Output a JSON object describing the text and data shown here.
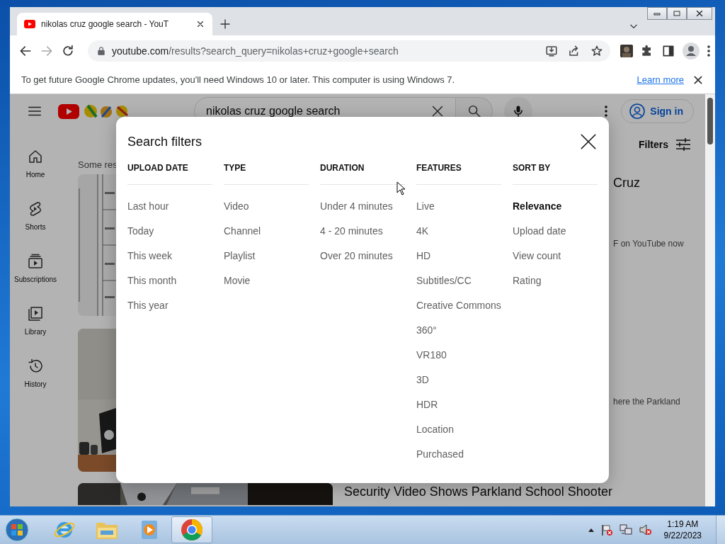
{
  "browser": {
    "tab": {
      "title": "nikolas cruz google search - YouT"
    },
    "address": {
      "domain": "youtube.com",
      "path": "/results?search_query=nikolas+cruz+google+search"
    },
    "infobar": {
      "message": "To get future Google Chrome updates, you'll need Windows 10 or later. This computer is using Windows 7.",
      "link": "Learn more"
    }
  },
  "page": {
    "search": {
      "value": "nikolas cruz google search"
    },
    "sign_in": "Sign in",
    "filters_button": "Filters",
    "guide": [
      {
        "label": "Home"
      },
      {
        "label": "Shorts"
      },
      {
        "label": "Subscriptions"
      },
      {
        "label": "Library"
      },
      {
        "label": "History"
      }
    ],
    "results_note": "Some res",
    "results": [
      {
        "title": "Cruz",
        "snippet": "F on YouTube now"
      },
      {
        "snippet": "here the Parkland"
      },
      {
        "title": "Security Video Shows Parkland School Shooter"
      }
    ]
  },
  "filters": {
    "title": "Search filters",
    "groups": [
      {
        "heading": "UPLOAD DATE",
        "options": [
          {
            "label": "Last hour",
            "selected": false
          },
          {
            "label": "Today",
            "selected": false
          },
          {
            "label": "This week",
            "selected": false
          },
          {
            "label": "This month",
            "selected": false
          },
          {
            "label": "This year",
            "selected": false
          }
        ]
      },
      {
        "heading": "TYPE",
        "options": [
          {
            "label": "Video",
            "selected": false
          },
          {
            "label": "Channel",
            "selected": false
          },
          {
            "label": "Playlist",
            "selected": false
          },
          {
            "label": "Movie",
            "selected": false
          }
        ]
      },
      {
        "heading": "DURATION",
        "options": [
          {
            "label": "Under 4 minutes",
            "selected": false
          },
          {
            "label": "4 - 20 minutes",
            "selected": false
          },
          {
            "label": "Over 20 minutes",
            "selected": false
          }
        ]
      },
      {
        "heading": "FEATURES",
        "options": [
          {
            "label": "Live",
            "selected": false
          },
          {
            "label": "4K",
            "selected": false
          },
          {
            "label": "HD",
            "selected": false
          },
          {
            "label": "Subtitles/CC",
            "selected": false
          },
          {
            "label": "Creative Commons",
            "selected": false
          },
          {
            "label": "360°",
            "selected": false
          },
          {
            "label": "VR180",
            "selected": false
          },
          {
            "label": "3D",
            "selected": false
          },
          {
            "label": "HDR",
            "selected": false
          },
          {
            "label": "Location",
            "selected": false
          },
          {
            "label": "Purchased",
            "selected": false
          }
        ]
      },
      {
        "heading": "SORT BY",
        "options": [
          {
            "label": "Relevance",
            "selected": true
          },
          {
            "label": "Upload date",
            "selected": false
          },
          {
            "label": "View count",
            "selected": false
          },
          {
            "label": "Rating",
            "selected": false
          }
        ]
      }
    ]
  },
  "taskbar": {
    "time": "1:19 AM",
    "date": "9/22/2023"
  }
}
